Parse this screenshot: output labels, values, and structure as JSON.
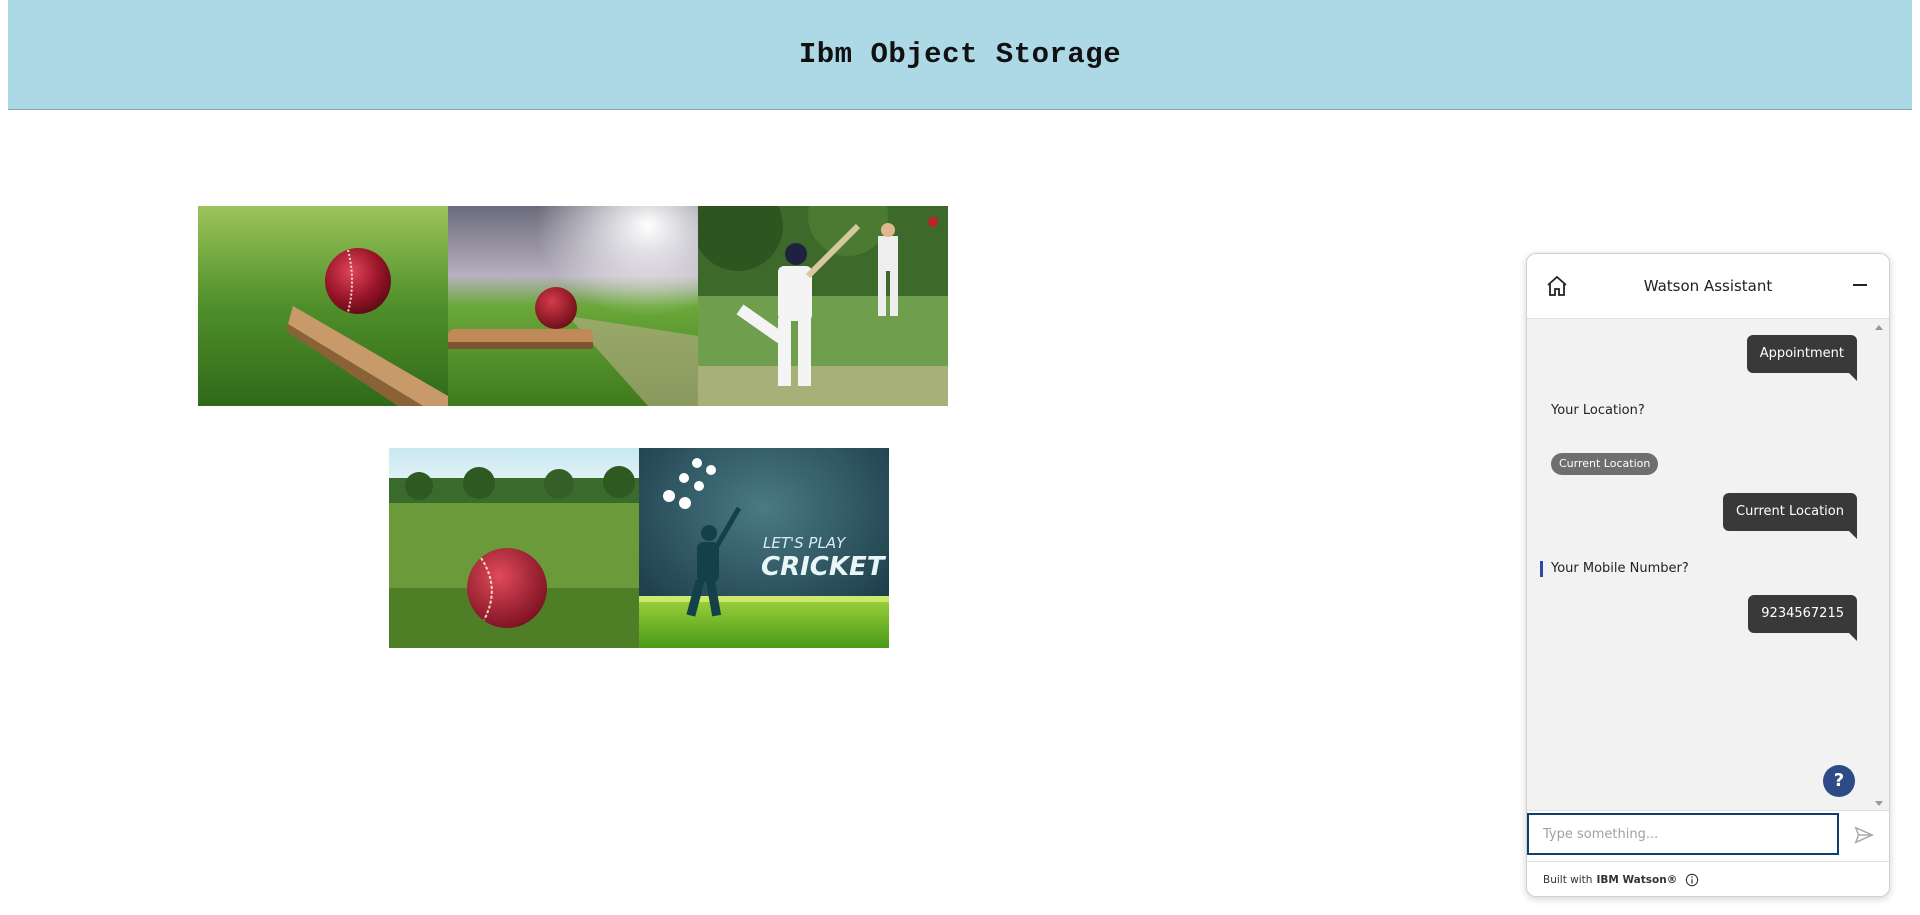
{
  "header": {
    "title": "Ibm Object Storage"
  },
  "gallery": {
    "images": [
      {
        "name": "cricket-ball-on-bat-grass"
      },
      {
        "name": "cricket-ball-on-bat-stadium"
      },
      {
        "name": "cricket-batsman-playing"
      },
      {
        "name": "cricket-ball-in-field"
      },
      {
        "name": "lets-play-cricket-poster",
        "poster_line1": "LET'S PLAY",
        "poster_line2": "CRICKET"
      }
    ]
  },
  "chat": {
    "title": "Watson Assistant",
    "messages": [
      {
        "from": "user",
        "text": "Appointment"
      },
      {
        "from": "bot",
        "text": "Your Location?"
      },
      {
        "from": "bot-option",
        "text": "Current Location"
      },
      {
        "from": "user",
        "text": "Current Location"
      },
      {
        "from": "bot",
        "text": "Your Mobile Number?"
      },
      {
        "from": "user",
        "text": "9234567215"
      }
    ],
    "input": {
      "placeholder": "Type something..."
    },
    "help_label": "?",
    "footer": {
      "built_with": "Built with",
      "brand": "IBM Watson®"
    },
    "icons": [
      "home-icon",
      "minimize-icon",
      "send-icon",
      "info-icon",
      "help-icon"
    ],
    "accent_color": "#0f3f6e",
    "bubble_color": "#393939"
  },
  "colors": {
    "header_bg": "#add8e6"
  }
}
